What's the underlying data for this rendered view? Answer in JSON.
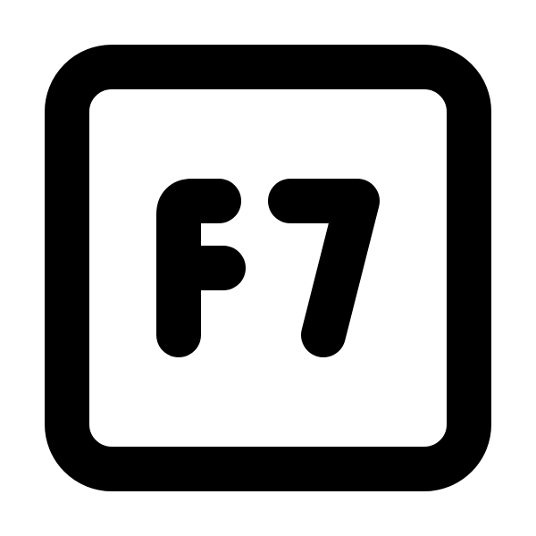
{
  "icon": {
    "name": "f7-key-icon",
    "label": "F7",
    "stroke_color": "#000000",
    "background_color": "#ffffff"
  }
}
